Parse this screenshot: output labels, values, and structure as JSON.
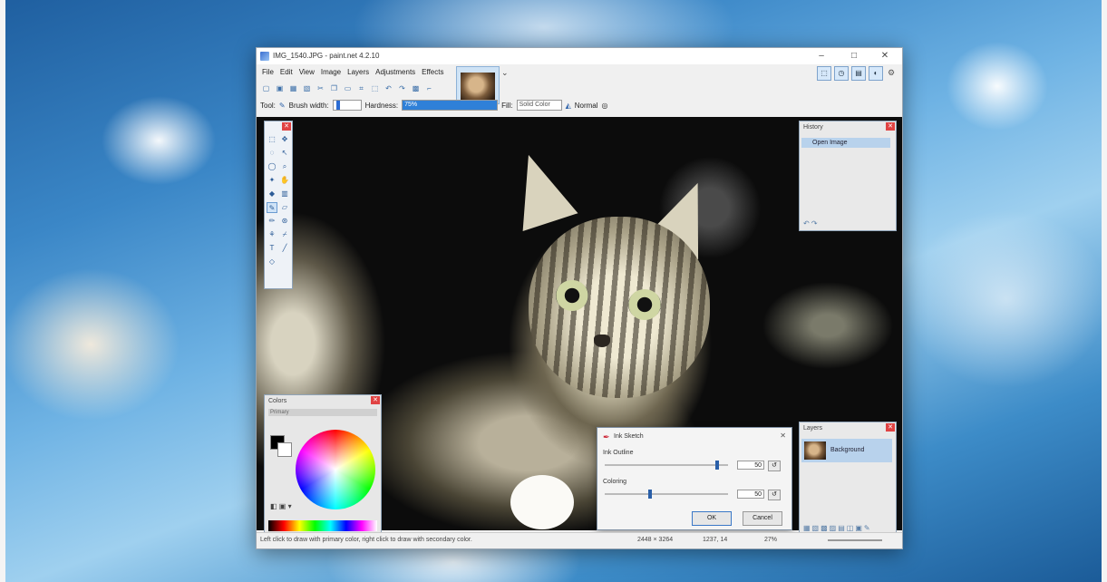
{
  "window": {
    "title": "IMG_1540.JPG - paint.net 4.2.10",
    "controls": {
      "minimize": "–",
      "maximize": "□",
      "close": "✕"
    }
  },
  "menu": [
    "File",
    "Edit",
    "View",
    "Image",
    "Layers",
    "Adjustments",
    "Effects"
  ],
  "toolbar_icons": [
    "new-icon",
    "open-icon",
    "save-icon",
    "print-icon",
    "cut-icon",
    "copy-icon",
    "paste-icon",
    "crop-icon",
    "deselect-icon",
    "undo-icon",
    "redo-icon",
    "grid-icon",
    "ruler-icon"
  ],
  "options": {
    "tool_label": "Tool:",
    "brush_width_label": "Brush width:",
    "hardness_label": "Hardness:",
    "hardness_value": "75%",
    "fill_label": "Fill:",
    "fill_value": "Solid Color",
    "blend_value": "Normal"
  },
  "history": {
    "title": "History",
    "items": [
      "Open Image"
    ]
  },
  "colors": {
    "title": "Colors",
    "mode": "Primary",
    "primary": "#000000",
    "secondary": "#ffffff"
  },
  "layers": {
    "title": "Layers",
    "items": [
      "Background"
    ]
  },
  "dialog": {
    "title": "Ink Sketch",
    "ink_outline_label": "Ink Outline",
    "ink_outline_value": "50",
    "coloring_label": "Coloring",
    "coloring_value": "50",
    "ok_label": "OK",
    "cancel_label": "Cancel",
    "ink_outline_level": 0.9,
    "coloring_level": 0.35
  },
  "status": {
    "hint": "Left click to draw with primary color, right click to draw with secondary color.",
    "size": "2448 × 3264",
    "coords": "1237, 14",
    "zoom": "27%"
  }
}
